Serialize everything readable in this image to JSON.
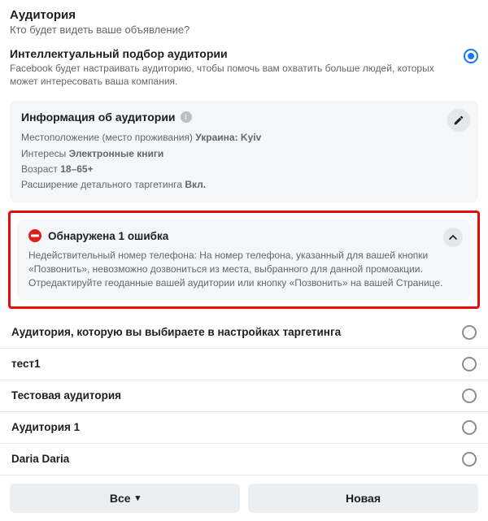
{
  "header": {
    "title": "Аудитория",
    "subtitle": "Кто будет видеть ваше объявление?"
  },
  "smart_option": {
    "title": "Интеллектуальный подбор аудитории",
    "description": "Facebook будет настраивать аудиторию, чтобы помочь вам охватить больше людей, которых может интересовать ваша компания."
  },
  "info_card": {
    "title": "Информация об аудитории",
    "location_label": "Местоположение (место проживания)",
    "location_value": "Украина: Kyiv",
    "interests_label": "Интересы",
    "interests_value": "Электронные книги",
    "age_label": "Возраст",
    "age_value": "18–65+",
    "expansion_label": "Расширение детального таргетинга",
    "expansion_value": "Вкл."
  },
  "error": {
    "title": "Обнаружена 1 ошибка",
    "body": "Недействительный номер телефона: На номер телефона, указанный для вашей кнопки «Позвонить», невозможно дозвониться из места, выбранного для данной промоакции. Отредактируйте геоданные вашей аудитории или кнопку «Позвонить» на вашей Странице."
  },
  "audiences": [
    {
      "label": "Аудитория, которую вы выбираете в настройках таргетинга"
    },
    {
      "label": "тест1"
    },
    {
      "label": "Тестовая аудитория"
    },
    {
      "label": "Аудитория 1"
    },
    {
      "label": "Daria Daria"
    }
  ],
  "buttons": {
    "all": "Все",
    "new": "Новая"
  }
}
